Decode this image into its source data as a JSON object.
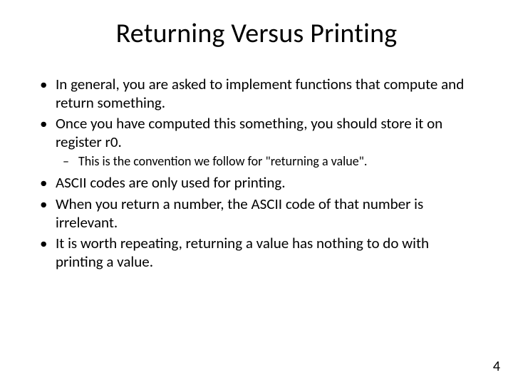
{
  "title": "Returning Versus Printing",
  "bullets": {
    "b1": "In general, you are asked to implement functions that compute and return something.",
    "b2": "Once you have computed this something, you should store it on register r0.",
    "b2_sub1": "This is the convention we follow for \"returning a value\".",
    "b3": "ASCII codes are only used for printing.",
    "b4": "When you return a number, the ASCII code of that number is irrelevant.",
    "b5": "It is worth repeating, returning a value has nothing to do with printing a value."
  },
  "page_number": "4"
}
